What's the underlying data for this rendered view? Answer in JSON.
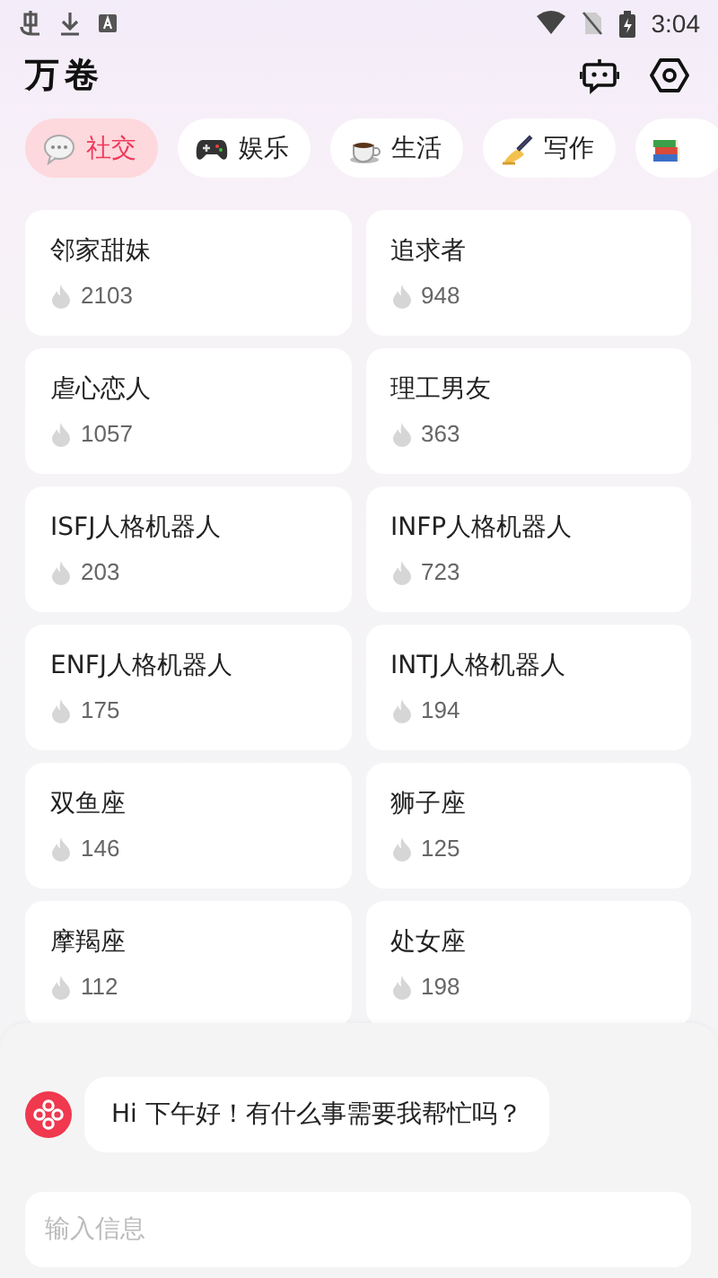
{
  "status_bar": {
    "time": "3:04"
  },
  "app": {
    "title": "万卷"
  },
  "tabs": [
    {
      "label": "社交",
      "selected": true
    },
    {
      "label": "娱乐",
      "selected": false
    },
    {
      "label": "生活",
      "selected": false
    },
    {
      "label": "写作",
      "selected": false
    },
    {
      "selected": false
    }
  ],
  "cards": [
    {
      "name": "邻家甜妹",
      "count": "2103"
    },
    {
      "name": "追求者",
      "count": "948"
    },
    {
      "name": "虐心恋人",
      "count": "1057"
    },
    {
      "name": "理工男友",
      "count": "363"
    },
    {
      "name": "ISFJ人格机器人",
      "count": "203"
    },
    {
      "name": "INFP人格机器人",
      "count": "723"
    },
    {
      "name": "ENFJ人格机器人",
      "count": "175"
    },
    {
      "name": "INTJ人格机器人",
      "count": "194"
    },
    {
      "name": "双鱼座",
      "count": "146"
    },
    {
      "name": "狮子座",
      "count": "125"
    },
    {
      "name": "摩羯座",
      "count": "112"
    },
    {
      "name": "处女座",
      "count": "198"
    }
  ],
  "chat": {
    "message": "Hi 下午好！有什么事需要我帮忙吗？",
    "input": {
      "placeholder": "输入信息"
    }
  }
}
